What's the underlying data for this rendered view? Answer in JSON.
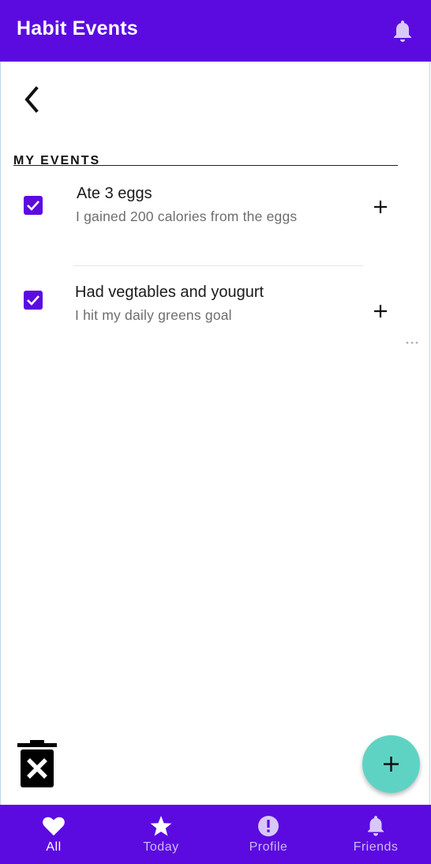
{
  "app_bar": {
    "title": "Habit Events",
    "notification_icon": "bell-icon"
  },
  "back_icon": "chevron-left-icon",
  "section": {
    "title": "MY EVENTS"
  },
  "events": [
    {
      "title": "Ate 3 eggs",
      "description": "I gained 200 calories from the eggs",
      "checked": true
    },
    {
      "title": "Had vegtables and yougurt",
      "description": "I hit my daily greens goal",
      "checked": true
    }
  ],
  "trash_icon": "delete-forever-icon",
  "fab_icon": "plus-icon",
  "bottom_nav": {
    "items": [
      {
        "label": "All",
        "icon": "heart-icon",
        "active": true
      },
      {
        "label": "Today",
        "icon": "star-icon",
        "active": false
      },
      {
        "label": "Profile",
        "icon": "exclamation-circle-icon",
        "active": false
      },
      {
        "label": "Friends",
        "icon": "bell-icon",
        "active": false
      }
    ]
  },
  "colors": {
    "primary": "#5b0be0",
    "fab": "#5fd3c3",
    "inactive_nav": "#cdb9f4"
  }
}
